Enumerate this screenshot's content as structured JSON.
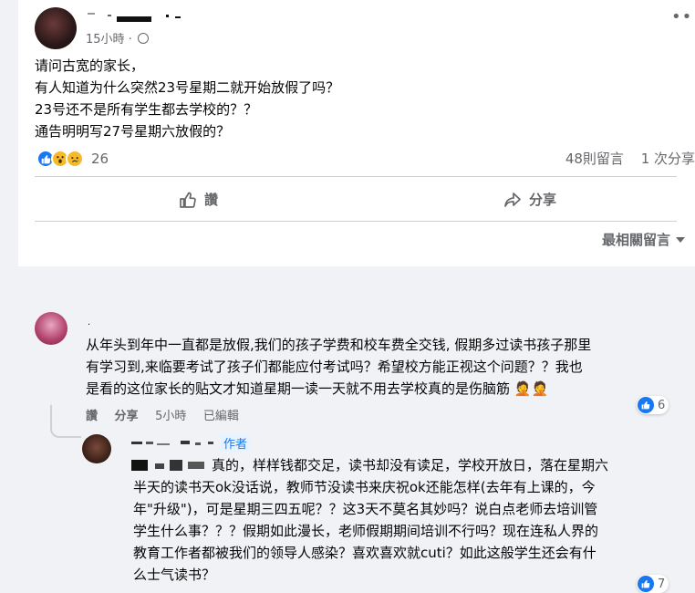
{
  "post": {
    "time": "15小時",
    "separator": "·",
    "more": "•••",
    "lines": [
      "请问古宽的家长，",
      "有人知道为什么突然23号星期二就开始放假了吗？",
      "23号还不是所有学生都去学校的？？",
      "通告明明写27号星期六放假的？"
    ],
    "reaction_count": "26",
    "comments_count": "48則留言",
    "shares_count": "1 次分享",
    "like_label": "讚",
    "share_label": "分享",
    "sort_label": "最相關留言"
  },
  "comments": [
    {
      "author_visible": ".",
      "lines": [
        "从年头到年中一直都是放假,我们的孩子学费和校车费全交钱, 假期多过读书孩子那里",
        "有学习到,来临要考试了孩子们都能应付考试吗？希望校方能正视这个问题？？我也",
        "是看的这位家长的贴文才知道星期一读一天就不用去学校真的是伤脑筋 🤦🤦"
      ],
      "like_label": "讚",
      "share_label": "分享",
      "time": "5小時",
      "edited": "已編輯",
      "reaction_count": "6"
    },
    {
      "badge": "作者",
      "first_line_tail": "真的，样样钱都交足，读书却没有读足，学校开放日，落在星期六",
      "lines": [
        "半天的读书天ok没话说，教师节没读书来庆祝ok还能怎样(去年有上课的，今",
        "年\"升级\")，可是星期三四五呢？？这3天不莫名其妙吗？说白点老师去培训管",
        "学生什么事？？？假期如此漫长，老师假期期间培训不行吗？现在连私人界的",
        "教育工作者都被我们的领导人感染？喜欢喜欢就cuti？如此这般学生还会有什",
        "么士气读书？"
      ],
      "reaction_count": "7"
    }
  ],
  "colors": {
    "accent": "#1877f2",
    "meta_text": "#65676b",
    "bubble": "#f0f2f5"
  },
  "icons": [
    "globe-icon",
    "more-icon",
    "like-icon",
    "share-icon",
    "chevron-down-icon"
  ]
}
